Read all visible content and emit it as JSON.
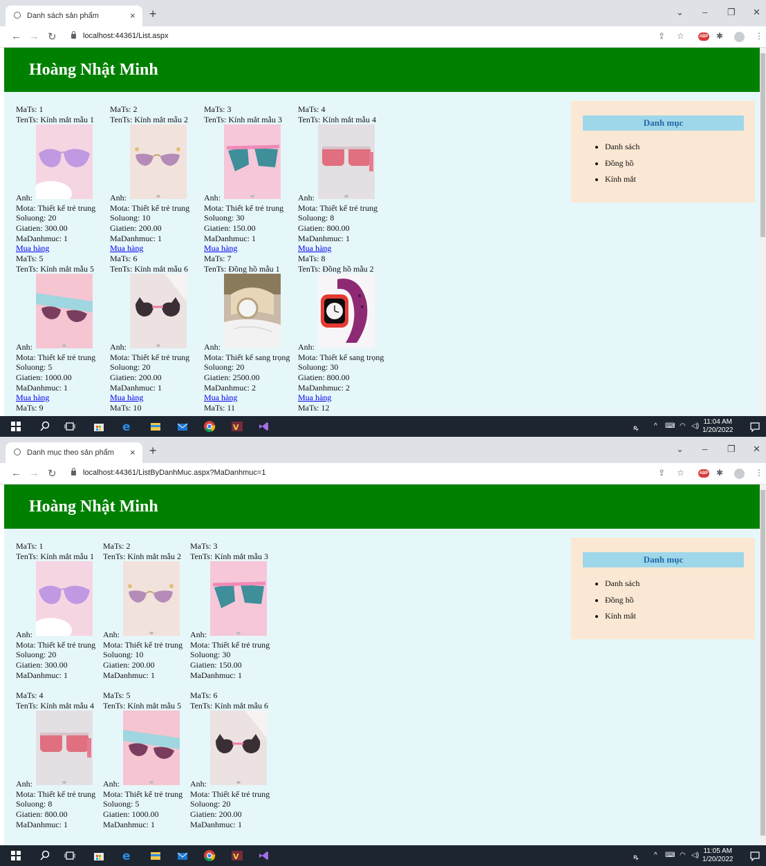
{
  "site_title": "Hoàng Nhật Minh",
  "sidebar": {
    "title": "Danh mục",
    "items": [
      "Danh sách",
      "Đồng hồ",
      "Kính mắt"
    ]
  },
  "buy_label": "Mua hàng",
  "windows": [
    {
      "tab_title": "Danh sách sản phẩm",
      "url": "localhost:44361/List.aspx",
      "clock_time": "11:04 AM",
      "clock_date": "1/20/2022",
      "products": [
        {
          "mats": "MaTs: 1",
          "tents": "TenTs: Kính mắt mẫu 1",
          "anh": "Anh:",
          "mota": "Mota: Thiết kế trẻ trung",
          "soluong": "Soluong: 20",
          "giatien": "Giatien: 300.00",
          "madanhmuc": "MaDanhmuc: 1"
        },
        {
          "mats": "MaTs: 2",
          "tents": "TenTs: Kính mắt mẫu 2",
          "anh": "Anh:",
          "mota": "Mota: Thiết kế trẻ trung",
          "soluong": "Soluong: 10",
          "giatien": "Giatien: 200.00",
          "madanhmuc": "MaDanhmuc: 1"
        },
        {
          "mats": "MaTs: 3",
          "tents": "TenTs: Kính mắt mẫu 3",
          "anh": "Anh:",
          "mota": "Mota: Thiết kế trẻ trung",
          "soluong": "Soluong: 30",
          "giatien": "Giatien: 150.00",
          "madanhmuc": "MaDanhmuc: 1"
        },
        {
          "mats": "MaTs: 4",
          "tents": "TenTs: Kính mắt mẫu 4",
          "anh": "Anh:",
          "mota": "Mota: Thiết kế trẻ trung",
          "soluong": "Soluong: 8",
          "giatien": "Giatien: 800.00",
          "madanhmuc": "MaDanhmuc: 1"
        },
        {
          "mats": "MaTs: 5",
          "tents": "TenTs: Kính mắt mẫu 5",
          "anh": "Anh:",
          "mota": "Mota: Thiết kế trẻ trung",
          "soluong": "Soluong: 5",
          "giatien": "Giatien: 1000.00",
          "madanhmuc": "MaDanhmuc: 1"
        },
        {
          "mats": "MaTs: 6",
          "tents": "TenTs: Kính mắt mẫu 6",
          "anh": "Anh:",
          "mota": "Mota: Thiết kế trẻ trung",
          "soluong": "Soluong: 20",
          "giatien": "Giatien: 200.00",
          "madanhmuc": "MaDanhmuc: 1"
        },
        {
          "mats": "MaTs: 7",
          "tents": "TenTs: Đồng hồ mẫu 1",
          "anh": "Anh:",
          "mota": "Mota: Thiết kế sang trọng",
          "soluong": "Soluong: 20",
          "giatien": "Giatien: 2500.00",
          "madanhmuc": "MaDanhmuc: 2"
        },
        {
          "mats": "MaTs: 8",
          "tents": "TenTs: Đồng hồ mẫu 2",
          "anh": "Anh:",
          "mota": "Mota: Thiết kế sang trọng",
          "soluong": "Soluong: 30",
          "giatien": "Giatien: 800.00",
          "madanhmuc": "MaDanhmuc: 2"
        },
        {
          "mats": "MaTs: 9"
        },
        {
          "mats": "MaTs: 10"
        },
        {
          "mats": "MaTs: 11"
        },
        {
          "mats": "MaTs: 12"
        }
      ]
    },
    {
      "tab_title": "Danh mục theo sản phẩm",
      "url": "localhost:44361/ListByDanhMuc.aspx?MaDanhmuc=1",
      "clock_time": "11:05 AM",
      "clock_date": "1/20/2022",
      "products": [
        {
          "mats": "MaTs: 1",
          "tents": "TenTs: Kính mắt mẫu 1",
          "anh": "Anh:",
          "mota": "Mota: Thiết kế trẻ trung",
          "soluong": "Soluong: 20",
          "giatien": "Giatien: 300.00",
          "madanhmuc": "MaDanhmuc: 1"
        },
        {
          "mats": "MaTs: 2",
          "tents": "TenTs: Kính mắt mẫu 2",
          "anh": "Anh:",
          "mota": "Mota: Thiết kế trẻ trung",
          "soluong": "Soluong: 10",
          "giatien": "Giatien: 200.00",
          "madanhmuc": "MaDanhmuc: 1"
        },
        {
          "mats": "MaTs: 3",
          "tents": "TenTs: Kính mắt mẫu 3",
          "anh": "Anh:",
          "mota": "Mota: Thiết kế trẻ trung",
          "soluong": "Soluong: 30",
          "giatien": "Giatien: 150.00",
          "madanhmuc": "MaDanhmuc: 1"
        },
        {
          "mats": "MaTs: 4",
          "tents": "TenTs: Kính mắt mẫu 4",
          "anh": "Anh:",
          "mota": "Mota: Thiết kế trẻ trung",
          "soluong": "Soluong: 8",
          "giatien": "Giatien: 800.00",
          "madanhmuc": "MaDanhmuc: 1"
        },
        {
          "mats": "MaTs: 5",
          "tents": "TenTs: Kính mắt mẫu 5",
          "anh": "Anh:",
          "mota": "Mota: Thiết kế trẻ trung",
          "soluong": "Soluong: 5",
          "giatien": "Giatien: 1000.00",
          "madanhmuc": "MaDanhmuc: 1"
        },
        {
          "mats": "MaTs: 6",
          "tents": "TenTs: Kính mắt mẫu 6",
          "anh": "Anh:",
          "mota": "Mota: Thiết kế trẻ trung",
          "soluong": "Soluong: 20",
          "giatien": "Giatien: 200.00",
          "madanhmuc": "MaDanhmuc: 1"
        }
      ]
    }
  ]
}
